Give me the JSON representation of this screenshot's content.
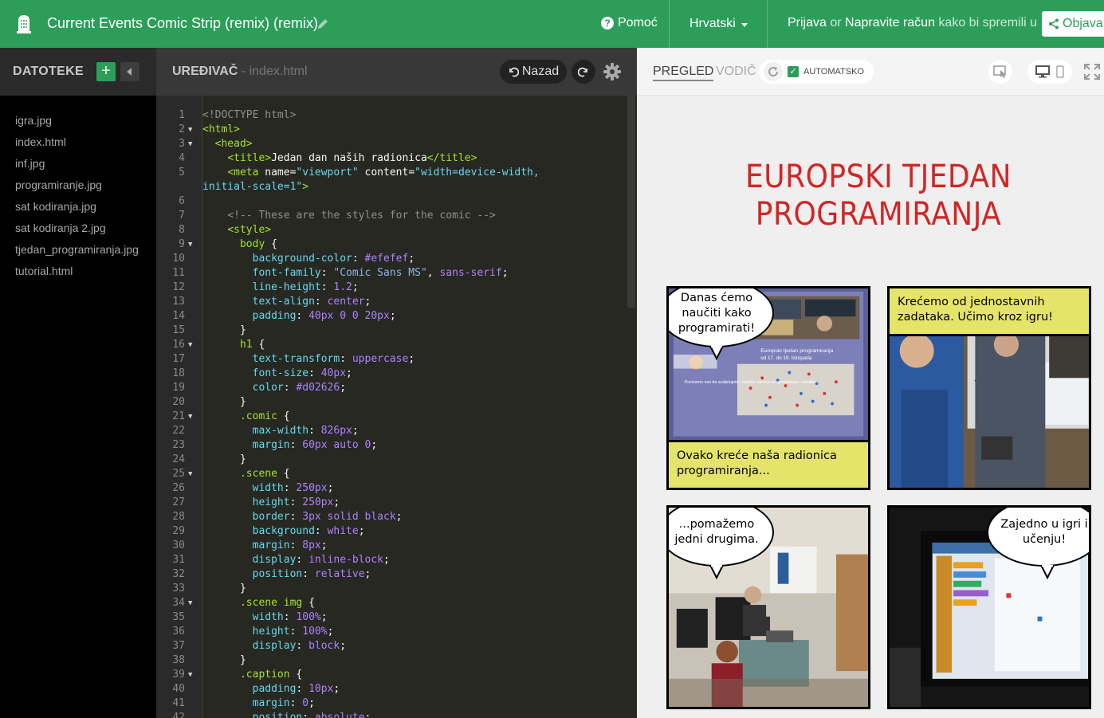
{
  "topbar": {
    "project_title": "Current Events Comic Strip (remix) (remix)",
    "help_label": "Pomoć",
    "language_label": "Hrvatski",
    "signin_label": "Prijava",
    "or_text": " or ",
    "create_account_label": "Napravite račun",
    "save_hint": " kako bi spremili u",
    "publish_label": "Objava",
    "brand_color": "#2c9e5a"
  },
  "files": {
    "title": "DATOTEKE",
    "add_label": "+",
    "items": [
      "igra.jpg",
      "index.html",
      "inf.jpg",
      "programiranje.jpg",
      "sat kodiranja.jpg",
      "sat kodiranja 2.jpg",
      "tjedan_programiranja.jpg",
      "tutorial.html"
    ]
  },
  "editor": {
    "title": "UREĐIVAČ",
    "file_suffix": " - index.html",
    "undo_label": "Nazad",
    "code_lines": [
      {
        "n": "1",
        "fold": false,
        "html": "<span class=\"c-com\">&lt;!DOCTYPE html&gt;</span>"
      },
      {
        "n": "2",
        "fold": true,
        "html": "<span class=\"c-tag\">&lt;html&gt;</span>"
      },
      {
        "n": "3",
        "fold": true,
        "html": "  <span class=\"c-tag\">&lt;head&gt;</span>"
      },
      {
        "n": "4",
        "fold": false,
        "html": "    <span class=\"c-tag\">&lt;title&gt;</span><span class=\"c-w\">Jedan dan naših radionica</span><span class=\"c-tag\">&lt;/title&gt;</span>"
      },
      {
        "n": "5",
        "fold": false,
        "html": "    <span class=\"c-tag\">&lt;meta </span><span class=\"c-w\">name=</span><span class=\"c-str\">\"viewport\"</span><span class=\"c-w\"> content=</span><span class=\"c-str\">\"width=device-width,</span>"
      },
      {
        "n": "",
        "fold": false,
        "html": "<span class=\"c-str\">initial-scale=1\"</span><span class=\"c-tag\">&gt;</span>"
      },
      {
        "n": "6",
        "fold": false,
        "html": ""
      },
      {
        "n": "7",
        "fold": false,
        "html": "    <span class=\"c-com\">&lt;!-- These are the styles for the comic --&gt;</span>"
      },
      {
        "n": "8",
        "fold": false,
        "html": "    <span class=\"c-tag\">&lt;style&gt;</span>"
      },
      {
        "n": "9",
        "fold": true,
        "html": "      <span class=\"c-sel\">body</span><span class=\"c-w\"> {</span>"
      },
      {
        "n": "10",
        "fold": false,
        "html": "        <span class=\"c-prop\">background-color</span><span class=\"c-w\">: </span><span class=\"c-val\">#efefef</span><span class=\"c-w\">;</span>"
      },
      {
        "n": "11",
        "fold": false,
        "html": "        <span class=\"c-prop\">font-family</span><span class=\"c-w\">: </span><span class=\"c-str2\">\"Comic Sans MS\"</span><span class=\"c-w\">, </span><span class=\"c-val\">sans-serif</span><span class=\"c-w\">;</span>"
      },
      {
        "n": "12",
        "fold": false,
        "html": "        <span class=\"c-prop\">line-height</span><span class=\"c-w\">: </span><span class=\"c-val\">1.2</span><span class=\"c-w\">;</span>"
      },
      {
        "n": "13",
        "fold": false,
        "html": "        <span class=\"c-prop\">text-align</span><span class=\"c-w\">: </span><span class=\"c-val\">center</span><span class=\"c-w\">;</span>"
      },
      {
        "n": "14",
        "fold": false,
        "html": "        <span class=\"c-prop\">padding</span><span class=\"c-w\">: </span><span class=\"c-val\">40px 0 0 20px</span><span class=\"c-w\">;</span>"
      },
      {
        "n": "15",
        "fold": false,
        "html": "      <span class=\"c-w\">}</span>"
      },
      {
        "n": "16",
        "fold": true,
        "html": "      <span class=\"c-sel\">h1</span><span class=\"c-w\"> {</span>"
      },
      {
        "n": "17",
        "fold": false,
        "html": "        <span class=\"c-prop\">text-transform</span><span class=\"c-w\">: </span><span class=\"c-val\">uppercase</span><span class=\"c-w\">;</span>"
      },
      {
        "n": "18",
        "fold": false,
        "html": "        <span class=\"c-prop\">font-size</span><span class=\"c-w\">: </span><span class=\"c-val\">40px</span><span class=\"c-w\">;</span>"
      },
      {
        "n": "19",
        "fold": false,
        "html": "        <span class=\"c-prop\">color</span><span class=\"c-w\">: </span><span class=\"c-val\">#d02626</span><span class=\"c-w\">;</span>"
      },
      {
        "n": "20",
        "fold": false,
        "html": "      <span class=\"c-w\">}</span>"
      },
      {
        "n": "21",
        "fold": true,
        "html": "      <span class=\"c-sel\">.comic</span><span class=\"c-w\"> {</span>"
      },
      {
        "n": "22",
        "fold": false,
        "html": "        <span class=\"c-prop\">max-width</span><span class=\"c-w\">: </span><span class=\"c-val\">826px</span><span class=\"c-w\">;</span>"
      },
      {
        "n": "23",
        "fold": false,
        "html": "        <span class=\"c-prop\">margin</span><span class=\"c-w\">: </span><span class=\"c-val\">60px auto 0</span><span class=\"c-w\">;</span>"
      },
      {
        "n": "24",
        "fold": false,
        "html": "      <span class=\"c-w\">}</span>"
      },
      {
        "n": "25",
        "fold": true,
        "html": "      <span class=\"c-sel\">.scene</span><span class=\"c-w\"> {</span>"
      },
      {
        "n": "26",
        "fold": false,
        "html": "        <span class=\"c-prop\">width</span><span class=\"c-w\">: </span><span class=\"c-val\">250px</span><span class=\"c-w\">;</span>"
      },
      {
        "n": "27",
        "fold": false,
        "html": "        <span class=\"c-prop\">height</span><span class=\"c-w\">: </span><span class=\"c-val\">250px</span><span class=\"c-w\">;</span>"
      },
      {
        "n": "28",
        "fold": false,
        "html": "        <span class=\"c-prop\">border</span><span class=\"c-w\">: </span><span class=\"c-val\">3px solid black</span><span class=\"c-w\">;</span>"
      },
      {
        "n": "29",
        "fold": false,
        "html": "        <span class=\"c-prop\">background</span><span class=\"c-w\">: </span><span class=\"c-val\">white</span><span class=\"c-w\">;</span>"
      },
      {
        "n": "30",
        "fold": false,
        "html": "        <span class=\"c-prop\">margin</span><span class=\"c-w\">: </span><span class=\"c-val\">8px</span><span class=\"c-w\">;</span>"
      },
      {
        "n": "31",
        "fold": false,
        "html": "        <span class=\"c-prop\">display</span><span class=\"c-w\">: </span><span class=\"c-val\">inline-block</span><span class=\"c-w\">;</span>"
      },
      {
        "n": "32",
        "fold": false,
        "html": "        <span class=\"c-prop\">position</span><span class=\"c-w\">: </span><span class=\"c-val\">relative</span><span class=\"c-w\">;</span>"
      },
      {
        "n": "33",
        "fold": false,
        "html": "      <span class=\"c-w\">}</span>"
      },
      {
        "n": "34",
        "fold": true,
        "html": "      <span class=\"c-sel\">.scene</span><span class=\"c-w\"> </span><span class=\"c-sel\">img</span><span class=\"c-w\"> {</span>"
      },
      {
        "n": "35",
        "fold": false,
        "html": "        <span class=\"c-prop\">width</span><span class=\"c-w\">: </span><span class=\"c-val\">100%</span><span class=\"c-w\">;</span>"
      },
      {
        "n": "36",
        "fold": false,
        "html": "        <span class=\"c-prop\">height</span><span class=\"c-w\">: </span><span class=\"c-val\">100%</span><span class=\"c-w\">;</span>"
      },
      {
        "n": "37",
        "fold": false,
        "html": "        <span class=\"c-prop\">display</span><span class=\"c-w\">: </span><span class=\"c-val\">block</span><span class=\"c-w\">;</span>"
      },
      {
        "n": "38",
        "fold": false,
        "html": "      <span class=\"c-w\">}</span>"
      },
      {
        "n": "39",
        "fold": true,
        "html": "      <span class=\"c-sel\">.caption</span><span class=\"c-w\"> {</span>"
      },
      {
        "n": "40",
        "fold": false,
        "html": "        <span class=\"c-prop\">padding</span><span class=\"c-w\">: </span><span class=\"c-val\">10px</span><span class=\"c-w\">;</span>"
      },
      {
        "n": "41",
        "fold": false,
        "html": "        <span class=\"c-prop\">margin</span><span class=\"c-w\">: </span><span class=\"c-val\">0</span><span class=\"c-w\">;</span>"
      },
      {
        "n": "42",
        "fold": false,
        "html": "        <span class=\"c-prop\">position</span><span class=\"c-w\">: </span><span class=\"c-val\">absolute</span><span class=\"c-w\">;</span>"
      }
    ]
  },
  "preview": {
    "tab_preview": "PREGLED",
    "tab_guide": "VODIČ",
    "auto_label": "AUTOMATSKO",
    "heading_line1": "Europski tjedan",
    "heading_line2": "programiranja",
    "heading_color": "#d02626",
    "caption_color": "#e4e46b",
    "scenes": {
      "s1_bubble": "Danas ćemo naučiti kako programirati!",
      "s1_caption": "Ovako kreće naša radionica programiranja...",
      "s1_poster_title": "Europski tjedan programiranja",
      "s1_poster_dates": "od 17. do 19. listopada",
      "s1_poster_text": "Pozivamo vas da sudjelujete i naučite osnove programiranja i robotike.",
      "s2_caption": "Krećemo od jednostavnih zadataka. Učimo kroz igru!",
      "s3_bubble": "...pomažemo jedni drugima.",
      "s4_bubble": "Zajedno u igri i učenju!"
    }
  }
}
